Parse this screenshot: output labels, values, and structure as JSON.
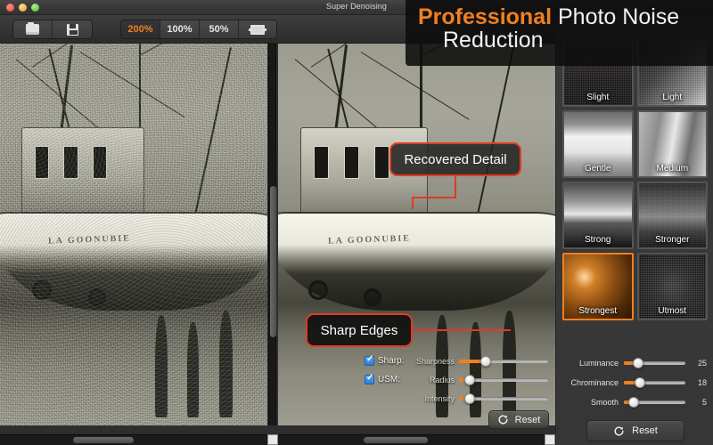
{
  "window": {
    "title": "Super Denoising",
    "controls": [
      "close",
      "minimize",
      "zoom"
    ]
  },
  "toolbar": {
    "open_label": "",
    "save_label": "",
    "zoom_levels": [
      {
        "label": "200%",
        "active": true
      },
      {
        "label": "100%",
        "active": false
      },
      {
        "label": "50%",
        "active": false
      }
    ],
    "fit_label": ""
  },
  "banner": {
    "line1_accent": "Professional",
    "line1_rest": " Photo Noise",
    "line2": "Reduction",
    "accent_color": "#f08020"
  },
  "callouts": [
    {
      "text": "Recovered Detail",
      "border_color": "#e03b22"
    },
    {
      "text": "Sharp Edges",
      "border_color": "#e03b22"
    }
  ],
  "preview": {
    "hull_text": "LA GOONUBIE"
  },
  "center_controls": {
    "checkboxes": [
      {
        "label": "Sharp:",
        "checked": true
      },
      {
        "label": "USM:",
        "checked": true
      }
    ],
    "sliders": [
      {
        "label": "Sharpness",
        "percent": 30
      },
      {
        "label": "Radius",
        "percent": 9
      },
      {
        "label": "Intensity",
        "percent": 9
      }
    ],
    "reset_label": "Reset"
  },
  "sidebar": {
    "presets": [
      {
        "label": "Slight",
        "selected": false,
        "thumb": "th-slight"
      },
      {
        "label": "Light",
        "selected": false,
        "thumb": "th-light"
      },
      {
        "label": "Gentle",
        "selected": false,
        "thumb": "th-gentle"
      },
      {
        "label": "Medium",
        "selected": false,
        "thumb": "th-medium"
      },
      {
        "label": "Strong",
        "selected": false,
        "thumb": "th-strong"
      },
      {
        "label": "Stronger",
        "selected": false,
        "thumb": "th-stronger"
      },
      {
        "label": "Strongest",
        "selected": true,
        "thumb": "th-strongest"
      },
      {
        "label": "Utmost",
        "selected": false,
        "thumb": "th-utmost"
      }
    ],
    "sliders": [
      {
        "label": "Luminance",
        "value": "25",
        "percent": 22
      },
      {
        "label": "Chrominance",
        "value": "18",
        "percent": 24
      },
      {
        "label": "Smooth",
        "value": "5",
        "percent": 13
      }
    ],
    "reset_label": "Reset",
    "selected_color": "#f08020"
  }
}
